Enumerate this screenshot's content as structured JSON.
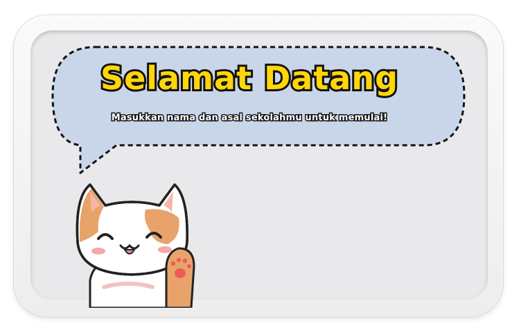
{
  "dialog": {
    "title": "Selamat Datang",
    "subtitle": "Masukkan nama dan asal sekolahmu untuk memulai!"
  },
  "colors": {
    "title_fill": "#ffd60a",
    "bubble_fill": "#c9d6ea",
    "panel_fill": "#e9e9eb",
    "cat_orange": "#e8a36b"
  },
  "icons": {
    "mascot": "waving-cat-icon",
    "paw": "paw-icon"
  }
}
